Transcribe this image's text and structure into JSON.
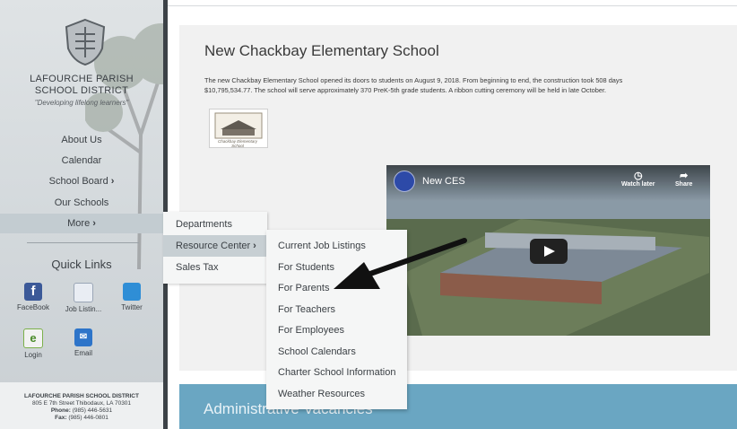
{
  "sidebar": {
    "district_line1": "LAFOURCHE PARISH",
    "district_line2": "SCHOOL DISTRICT",
    "motto": "\"Developing lifelong learners\"",
    "nav": [
      {
        "label": "About Us",
        "chev": ""
      },
      {
        "label": "Calendar",
        "chev": ""
      },
      {
        "label": "School Board",
        "chev": "›"
      },
      {
        "label": "Our Schools",
        "chev": ""
      },
      {
        "label": "More",
        "chev": "›"
      }
    ],
    "quick_links_title": "Quick Links",
    "quick_links": [
      {
        "label": "FaceBook",
        "icon": "facebook-icon",
        "color": "#3b5998"
      },
      {
        "label": "Job Listin...",
        "icon": "job-listing-icon",
        "color": "#e9edf3"
      },
      {
        "label": "Twitter",
        "icon": "twitter-icon",
        "color": "#2f8ed6"
      },
      {
        "label": "Login",
        "icon": "login-icon",
        "color": "#f2f2f2"
      },
      {
        "label": "Email",
        "icon": "email-icon",
        "color": "#2d74c9"
      }
    ],
    "footer": {
      "name": "LAFOURCHE PARISH SCHOOL DISTRICT",
      "address": "805 E 7th Street Thibodaux, LA 70301",
      "phone_label": "Phone:",
      "phone": "(985) 446-5631",
      "fax_label": "Fax:",
      "fax": "(985) 446-0801"
    }
  },
  "menu_more": {
    "items": [
      {
        "label": "Departments",
        "chev": ""
      },
      {
        "label": "Resource Center",
        "chev": "›"
      },
      {
        "label": "Sales Tax",
        "chev": ""
      }
    ]
  },
  "menu_resource": {
    "items": [
      "Current Job Listings",
      "For Students",
      "For Parents",
      "For Teachers",
      "For Employees",
      "School Calendars",
      "Charter School Information",
      "Weather Resources"
    ]
  },
  "article": {
    "title": "New Chackbay Elementary School",
    "text_line1": "The new Chackbay Elementary School opened its doors to students on August 9, 2018. From beginning to end, the construction took 508 days",
    "text_line2": "$10,795,534.77. The school will serve approximately 370 PreK-5th grade students. A ribbon cutting ceremony will be held in late October.",
    "thumb_caption": "Chackbay Elementary School"
  },
  "video": {
    "title": "New CES",
    "watch_later": "Watch later",
    "share": "Share"
  },
  "banner": {
    "title": "Administrative Vacancies"
  },
  "colors": {
    "sidebar_edge": "#3c4247",
    "banner": "#6aa6c2",
    "menu_active": "#c7cfd3"
  }
}
